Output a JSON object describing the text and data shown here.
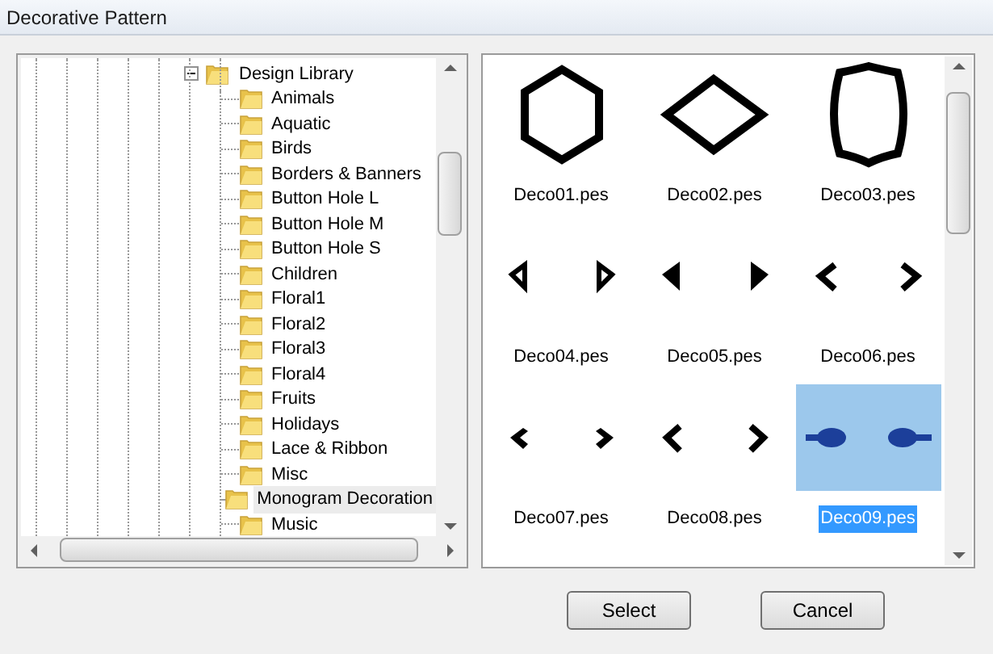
{
  "window": {
    "title": "Decorative Pattern"
  },
  "tree": {
    "label": "Design Library",
    "expanded": true,
    "children": [
      {
        "label": "Animals",
        "highlighted": false
      },
      {
        "label": "Aquatic",
        "highlighted": false
      },
      {
        "label": "Birds",
        "highlighted": false
      },
      {
        "label": "Borders & Banners",
        "highlighted": false
      },
      {
        "label": "Button Hole L",
        "highlighted": false
      },
      {
        "label": "Button Hole M",
        "highlighted": false
      },
      {
        "label": "Button Hole S",
        "highlighted": false
      },
      {
        "label": "Children",
        "highlighted": false
      },
      {
        "label": "Floral1",
        "highlighted": false
      },
      {
        "label": "Floral2",
        "highlighted": false
      },
      {
        "label": "Floral3",
        "highlighted": false
      },
      {
        "label": "Floral4",
        "highlighted": false
      },
      {
        "label": "Fruits",
        "highlighted": false
      },
      {
        "label": "Holidays",
        "highlighted": false
      },
      {
        "label": "Lace & Ribbon",
        "highlighted": false
      },
      {
        "label": "Misc",
        "highlighted": false
      },
      {
        "label": "Monogram Decoration",
        "highlighted": true
      },
      {
        "label": "Music",
        "highlighted": false
      }
    ]
  },
  "patterns": [
    {
      "name": "Deco01.pes",
      "kind": "hexagon",
      "selected": false
    },
    {
      "name": "Deco02.pes",
      "kind": "diamond",
      "selected": false
    },
    {
      "name": "Deco03.pes",
      "kind": "frame",
      "selected": false
    },
    {
      "name": "Deco04.pes",
      "kind": "outline-triangles",
      "selected": false
    },
    {
      "name": "Deco05.pes",
      "kind": "solid-triangles",
      "selected": false
    },
    {
      "name": "Deco06.pes",
      "kind": "chevrons",
      "selected": false
    },
    {
      "name": "Deco07.pes",
      "kind": "notched-arrows",
      "selected": false
    },
    {
      "name": "Deco08.pes",
      "kind": "double-chevrons",
      "selected": false
    },
    {
      "name": "Deco09.pes",
      "kind": "motifs",
      "selected": true
    }
  ],
  "buttons": [
    "Select",
    "Cancel"
  ]
}
